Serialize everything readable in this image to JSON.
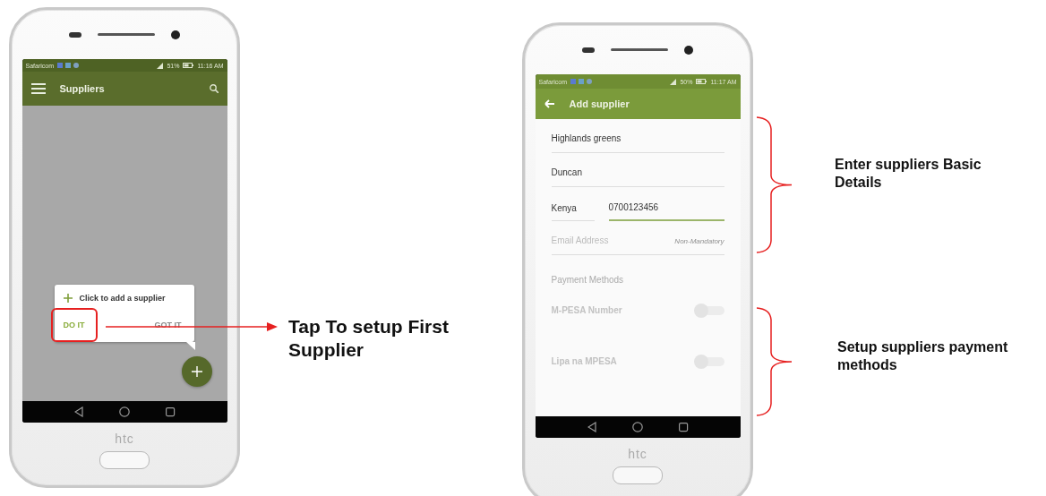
{
  "phone_1": {
    "status_bar": {
      "carrier": "Safaricom",
      "battery": "51%",
      "time": "11:16 AM"
    },
    "app_bar": {
      "title": "Suppliers"
    },
    "tooltip": {
      "text": "Click to add a supplier",
      "actions": [
        {
          "label": "DO IT",
          "highlighted": true
        },
        {
          "label": "GOT IT",
          "highlighted": false
        }
      ]
    },
    "brand": "htc"
  },
  "phone_2": {
    "status_bar": {
      "carrier": "Safaricom",
      "battery": "50%",
      "time": "11:17 AM"
    },
    "app_bar": {
      "title": "Add supplier"
    },
    "fields": [
      {
        "kind": "text",
        "value": "Highlands greens"
      },
      {
        "kind": "text",
        "value": "Duncan"
      },
      {
        "kind": "phone",
        "country": "Kenya",
        "value": "0700123456",
        "focused": true
      },
      {
        "kind": "email",
        "placeholder": "Email Address",
        "hint": "Non-Mandatory"
      }
    ],
    "section_label": "Payment Methods",
    "payment_methods": [
      {
        "label": "M-PESA Number",
        "on": false
      },
      {
        "label": "Lipa na MPESA",
        "on": false
      }
    ],
    "brand": "htc"
  },
  "annotations": [
    {
      "kind": "arrow",
      "text": "Tap To setup First Supplier"
    },
    {
      "kind": "bracket",
      "text": "Enter suppliers Basic Details"
    },
    {
      "kind": "bracket",
      "text": "Setup suppliers payment methods"
    }
  ]
}
